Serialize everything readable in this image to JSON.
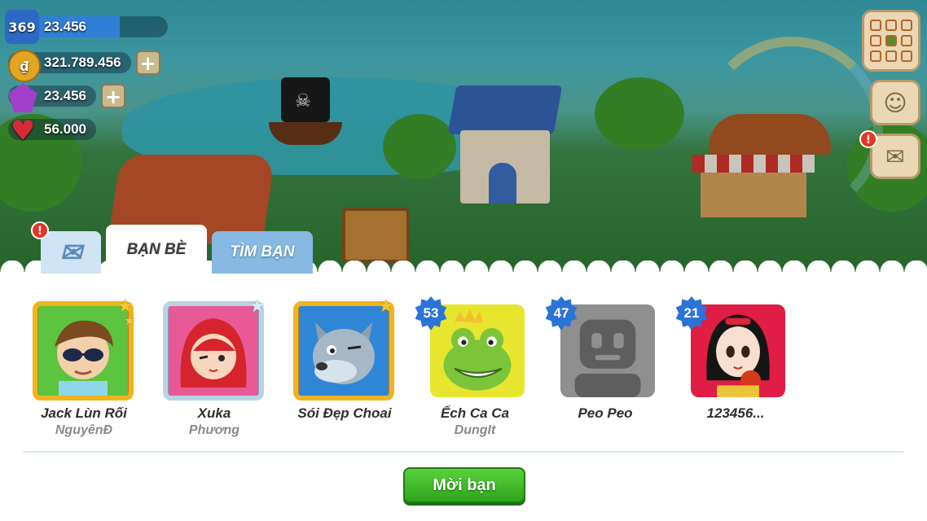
{
  "hud": {
    "level": "369",
    "xp": "23.456",
    "coins": "321.789.456",
    "gems": "23.456",
    "hearts": "56.000",
    "plus_symbol": "+"
  },
  "tabs": {
    "friends_label": "BẠN BÈ",
    "find_label": "TÌM BẠN",
    "alert_symbol": "!"
  },
  "side_buttons": {
    "alert_symbol": "!"
  },
  "friends": [
    {
      "name": "Jack Lùn Rối",
      "sub": "NguyênĐ",
      "level": "",
      "frame": "gold",
      "avatar": "boy-sunglasses"
    },
    {
      "name": "Xuka",
      "sub": "Phương",
      "level": "",
      "frame": "silver",
      "avatar": "red-hood-girl"
    },
    {
      "name": "Sói Đẹp Choai",
      "sub": "",
      "level": "",
      "frame": "gold",
      "avatar": "wolf"
    },
    {
      "name": "Ếch Ca Ca",
      "sub": "DungIt",
      "level": "53",
      "frame": "none",
      "avatar": "frog-king"
    },
    {
      "name": "Peo Peo",
      "sub": "",
      "level": "47",
      "frame": "none",
      "avatar": "default-avatar"
    },
    {
      "name": "123456...",
      "sub": "",
      "level": "21",
      "frame": "none",
      "avatar": "snow-white"
    }
  ],
  "invite_button": "Mời bạn"
}
